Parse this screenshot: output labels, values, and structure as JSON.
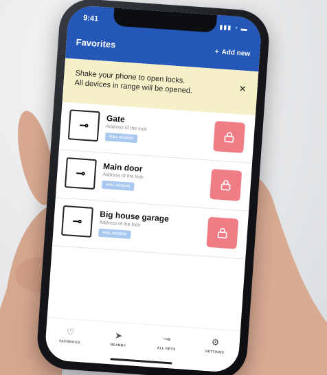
{
  "status": {
    "time": "9:41"
  },
  "header": {
    "title": "Favorites",
    "add_new": "Add new"
  },
  "banner": {
    "line1": "Shake your phone to open locks.",
    "line2": "All devices in range will be opened."
  },
  "locks": [
    {
      "name": "Gate",
      "address": "Address of the lock",
      "access": "FULL ACCESS"
    },
    {
      "name": "Main door",
      "address": "Address of the lock",
      "access": "FULL ACCESS"
    },
    {
      "name": "Big house garage",
      "address": "Address of the lock",
      "access": "FULL ACCESS"
    }
  ],
  "tabs": [
    {
      "label": "FAVORITES",
      "icon": "heart-icon"
    },
    {
      "label": "NEARBY",
      "icon": "navigation-arrow-icon"
    },
    {
      "label": "ALL KEYS",
      "icon": "key-icon"
    },
    {
      "label": "SETTINGS",
      "icon": "gear-icon"
    }
  ],
  "colors": {
    "header": "#2457b8",
    "banner": "#f5f0c8",
    "lock_button": "#f07d86",
    "badge": "#a8c8ef"
  }
}
